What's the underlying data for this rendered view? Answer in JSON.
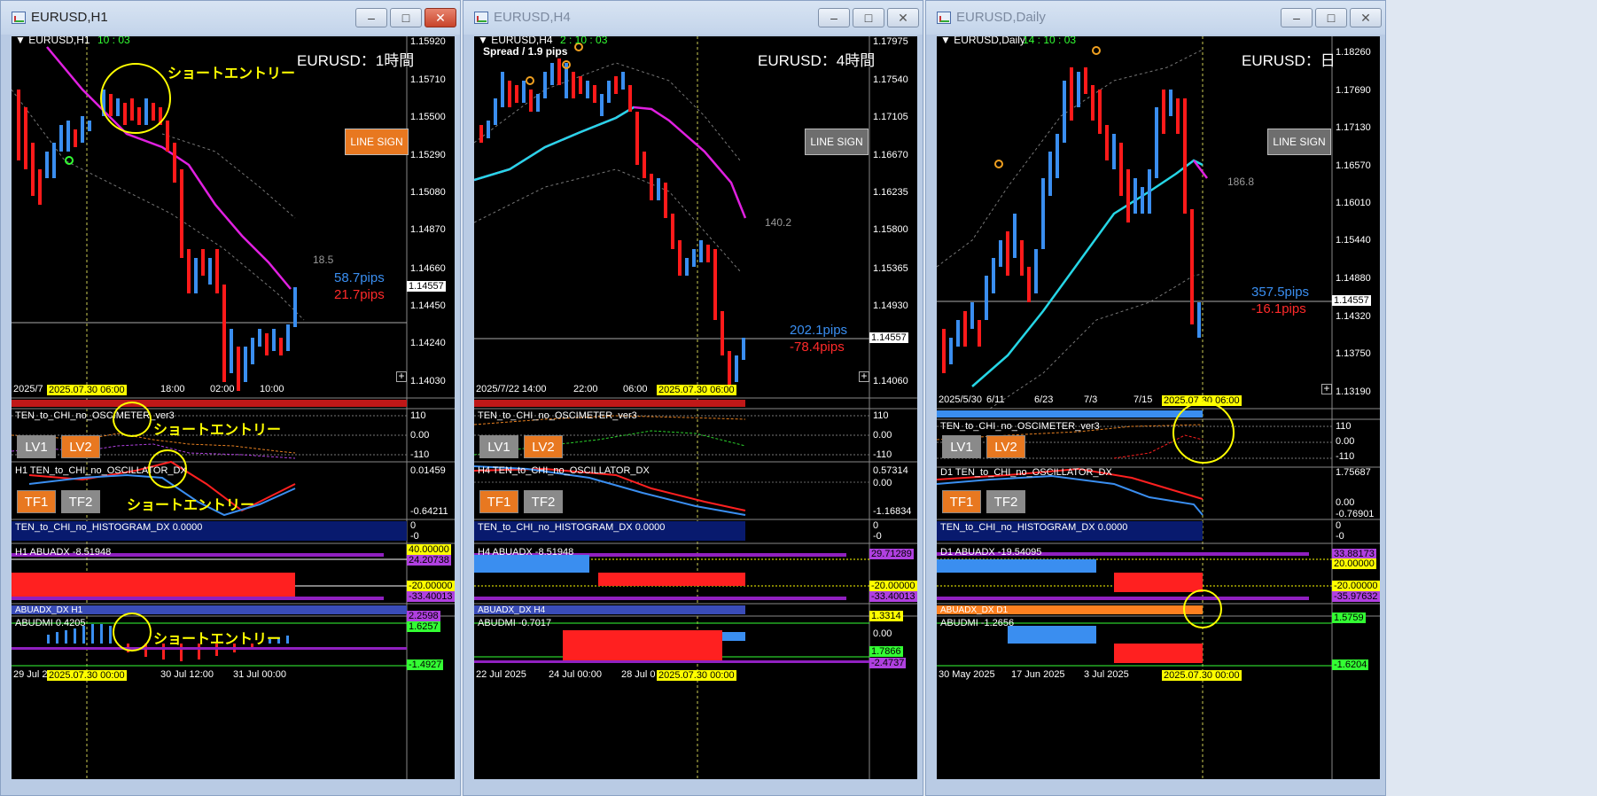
{
  "windows": [
    {
      "title": "EURUSD,H1",
      "active": true,
      "symbol_label": "EURUSD,H1",
      "timer": "10 : 03",
      "big_title": "EURUSD：1時間",
      "line_sign": "LINE SIGN",
      "line_sign_color": "#e87820",
      "pips_up": "58.7pips",
      "pips_down": "21.7pips",
      "side_value": "18.5",
      "price_labels": [
        "1.15920",
        "1.15710",
        "1.15500",
        "1.15290",
        "1.15080",
        "1.14870",
        "1.14660",
        "1.14557",
        "1.14450",
        "1.14240",
        "1.14030"
      ],
      "time_labels": [
        "2025/7",
        "18:00",
        "02:00",
        "10:00"
      ],
      "time_tag": "2025.07.30 06:00",
      "bottom_labels": [
        "29 Jul 2",
        "30 Jul 12:00",
        "31 Jul 00:00"
      ],
      "bottom_tag": "2025.07.30 00:00",
      "annotations": [
        "ショートエントリー",
        "ショートエントリー",
        "ショートエントリー",
        "ショートエントリー"
      ],
      "osc_title": "TEN_to_CHI_no_OSCIMETER_ver3",
      "osc_values": [
        "110",
        "0.00",
        "-110"
      ],
      "osc_dx_title": "H1  TEN_to_CHI_no_OSCILLATOR_DX",
      "osc_dx_values": [
        "0.01459",
        "-0.64211"
      ],
      "hist_title": "TEN_to_CHI_no_HISTOGRAM_DX 0.0000",
      "hist_values": [
        "0",
        "-0"
      ],
      "abuadx_title": "H1  ABUADX -8.51948",
      "abuadx_values": [
        "40.00000",
        "24.20738",
        "-20.00000",
        "-33.40013"
      ],
      "abuadx_dx_title": "ABUADX_DX H1",
      "abudmi_title": "ABUDMI 0.4205",
      "abudmi_values": [
        "2.2598",
        "1.6257",
        "-1.4927"
      ],
      "lv": [
        "LV1",
        "LV2"
      ],
      "tf": [
        "TF1",
        "TF2"
      ]
    },
    {
      "title": "EURUSD,H4",
      "active": false,
      "symbol_label": "EURUSD,H4",
      "timer": "2 : 10 : 03",
      "spread": "Spread / 1.9 pips",
      "big_title": "EURUSD：4時間",
      "line_sign": "LINE SIGN",
      "line_sign_color": "#6e6e6e",
      "pips_up": "202.1pips",
      "pips_down": "-78.4pips",
      "side_value": "140.2",
      "price_labels": [
        "1.17975",
        "1.17540",
        "1.17105",
        "1.16670",
        "1.16235",
        "1.15800",
        "1.15365",
        "1.14930",
        "1.14557",
        "1.14060"
      ],
      "time_labels": [
        "2025/7/22 14:00",
        "22:00",
        "06:00"
      ],
      "time_tag": "2025.07.30 06:00",
      "bottom_labels": [
        "22 Jul 2025",
        "24 Jul 00:00",
        "28 Jul 0"
      ],
      "bottom_tag": "2025.07.30 00:00",
      "osc_title": "TEN_to_CHI_no_OSCIMETER_ver3",
      "osc_values": [
        "110",
        "0.00",
        "-110"
      ],
      "osc_dx_title": "H4  TEN_to_CHI_no_OSCILLATOR_DX",
      "osc_dx_values": [
        "0.57314",
        "0.00",
        "-1.16834"
      ],
      "hist_title": "TEN_to_CHI_no_HISTOGRAM_DX 0.0000",
      "hist_values": [
        "0",
        "-0"
      ],
      "abuadx_title": "H4  ABUADX -8.51948",
      "abuadx_values": [
        "29.71289",
        "-20.00000",
        "-33.40013"
      ],
      "abuadx_dx_title": "ABUADX_DX H4",
      "abudmi_title": "ABUDMI -0.7017",
      "abudmi_values": [
        "1.3314",
        "0.00",
        "1.7866",
        "-2.4737"
      ],
      "lv": [
        "LV1",
        "LV2"
      ],
      "tf": [
        "TF1",
        "TF2"
      ]
    },
    {
      "title": "EURUSD,Daily",
      "active": false,
      "symbol_label": "EURUSD,Daily",
      "timer": "14 : 10 : 03",
      "big_title": "EURUSD：日",
      "line_sign": "LINE SIGN",
      "line_sign_color": "#6e6e6e",
      "pips_up": "357.5pips",
      "pips_down": "-16.1pips",
      "side_value": "186.8",
      "price_labels": [
        "1.18260",
        "1.17690",
        "1.17130",
        "1.16570",
        "1.16010",
        "1.15440",
        "1.14880",
        "1.14557",
        "1.14320",
        "1.13750",
        "1.13190"
      ],
      "time_labels": [
        "2025/5/30",
        "6/11",
        "6/23",
        "7/3",
        "7/15"
      ],
      "time_tag": "2025.07.30 06:00",
      "bottom_labels": [
        "30 May 2025",
        "17 Jun 2025",
        "3 Jul 2025"
      ],
      "bottom_tag": "2025.07.30 00:00",
      "osc_title": "TEN_to_CHI_no_OSCIMETER_ver3",
      "osc_values": [
        "110",
        "0.00",
        "-110"
      ],
      "osc_dx_title": "D1  TEN_to_CHI_no_OSCILLATOR_DX",
      "osc_dx_values": [
        "1.75687",
        "0.00",
        "-0.76901"
      ],
      "hist_title": "TEN_to_CHI_no_HISTOGRAM_DX 0.0000",
      "hist_values": [
        "0",
        "-0"
      ],
      "abuadx_title": "D1  ABUADX -19.54095",
      "abuadx_values": [
        "33.88173",
        "20.00000",
        "-20.00000",
        "-35.97632"
      ],
      "abuadx_dx_title": "ABUADX_DX D1",
      "abudmi_title": "ABUDMI -1.2656",
      "abudmi_values": [
        "1.5759",
        "-1.6204"
      ],
      "lv": [
        "LV1",
        "LV2"
      ],
      "tf": [
        "TF1",
        "TF2"
      ]
    }
  ]
}
